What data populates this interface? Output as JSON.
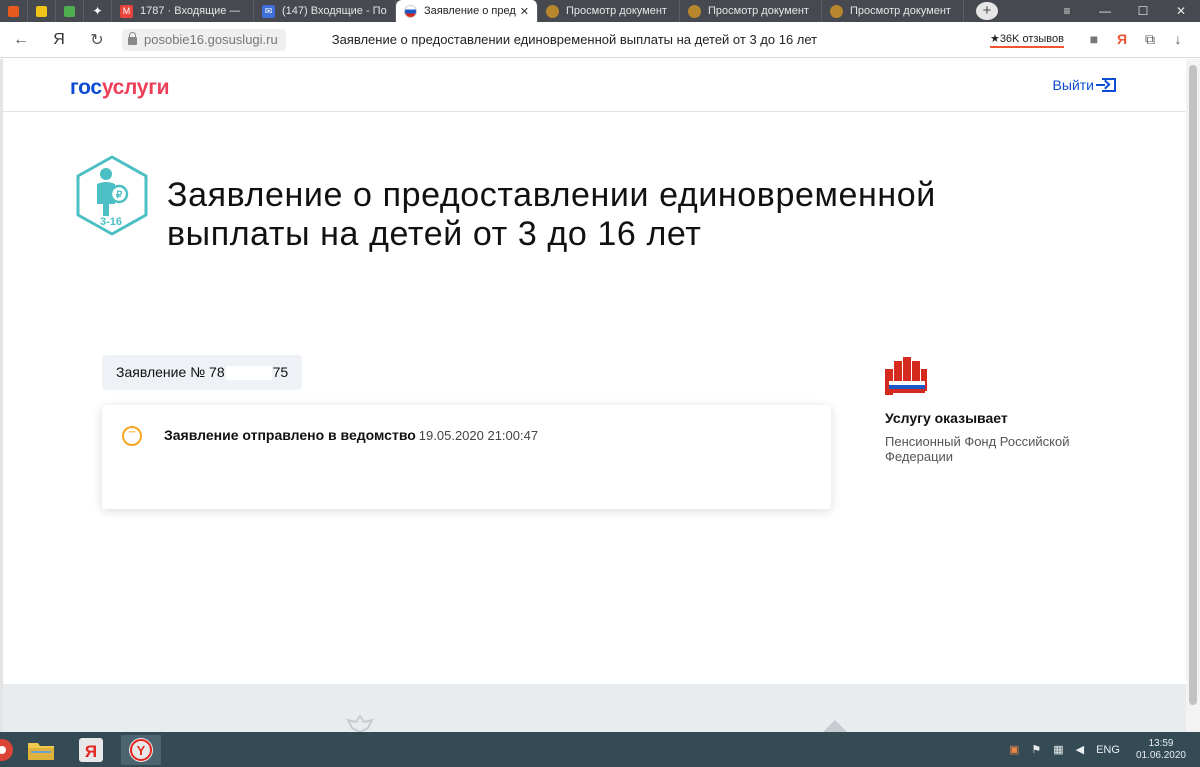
{
  "browser": {
    "tabs": [
      {
        "label": "1787 · Входящие — ",
        "fav_color": "#e8453c",
        "fav_glyph": "M"
      },
      {
        "label": "(147) Входящие - По",
        "fav_color": "#3f6fd9",
        "fav_glyph": "✉"
      },
      {
        "label": "Заявление о предо",
        "fav_color": "#e8ebf1",
        "fav_glyph": "",
        "active": true
      },
      {
        "label": "Просмотр документ",
        "fav_color": "#b8862d",
        "fav_glyph": ""
      },
      {
        "label": "Просмотр документ",
        "fav_color": "#b8862d",
        "fav_glyph": ""
      },
      {
        "label": "Просмотр документ",
        "fav_color": "#b8862d",
        "fav_glyph": ""
      }
    ],
    "url": "posobie16.gosuslugi.ru",
    "page_title": "Заявление о предоставлении единовременной выплаты на детей от 3 до 16 лет",
    "reviews_badge": "★36K отзывов"
  },
  "header": {
    "logo_part1": "гос",
    "logo_part2": "услуги",
    "logout_label": "Выйти"
  },
  "main": {
    "service_icon_label": "3-16",
    "heading": "Заявление о предоставлении единовременной выплаты на детей от 3 до 16 лет",
    "application_prefix": "Заявление № 78",
    "application_suffix": "75",
    "status_text": "Заявление отправлено в ведомство",
    "status_datetime": "19.05.2020 21:00:47"
  },
  "provider": {
    "title": "Услугу оказывает",
    "name": "Пенсионный Фонд Российской Федерации"
  },
  "taskbar": {
    "lang": "ENG",
    "time": "13:59",
    "date": "01.06.2020"
  },
  "colors": {
    "brand_blue": "#0d4cd3",
    "brand_red": "#ee3f58",
    "icon_teal": "#4bbfc3",
    "status_orange": "#f5a623"
  }
}
